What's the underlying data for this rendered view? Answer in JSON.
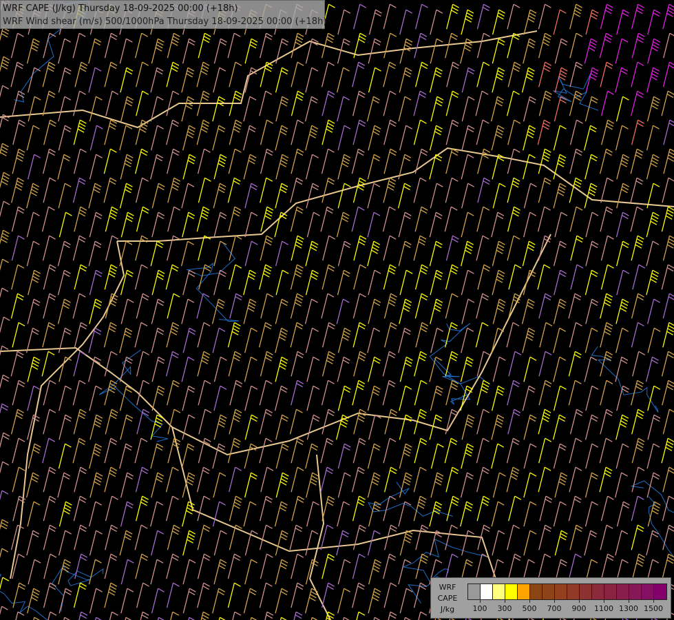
{
  "title": {
    "line1": "WRF CAPE (J/kg) Thursday 18-09-2025 00:00 (+18h)",
    "line2": "WRF Wind shear (m/s) 500/1000hPa Thursday 18-09-2025 00:00 (+18h)"
  },
  "legend": {
    "label_lines": [
      "WRF",
      "CAPE",
      "J/kg"
    ],
    "swatch_colors": [
      "#999999",
      "#ffffff",
      "#ffff80",
      "#ffff00",
      "#ffa500",
      "#8b4513",
      "#8f4318",
      "#93401e",
      "#913a28",
      "#8e3131",
      "#8b2a3a",
      "#882442",
      "#871e4c",
      "#861858",
      "#850f62",
      "#84006c"
    ],
    "tick_labels": [
      "100",
      "300",
      "500",
      "700",
      "900",
      "1100",
      "1300",
      "1500"
    ]
  },
  "barb_colors": {
    "pink": "#d4938f",
    "tan": "#d6a54a",
    "yellow": "#ffff00",
    "purple": "#a86cd0",
    "salmon": "#f07060",
    "magenta": "#e020e0"
  },
  "map_colors": {
    "border": "#e8c890",
    "river": "#1e6ec8"
  }
}
